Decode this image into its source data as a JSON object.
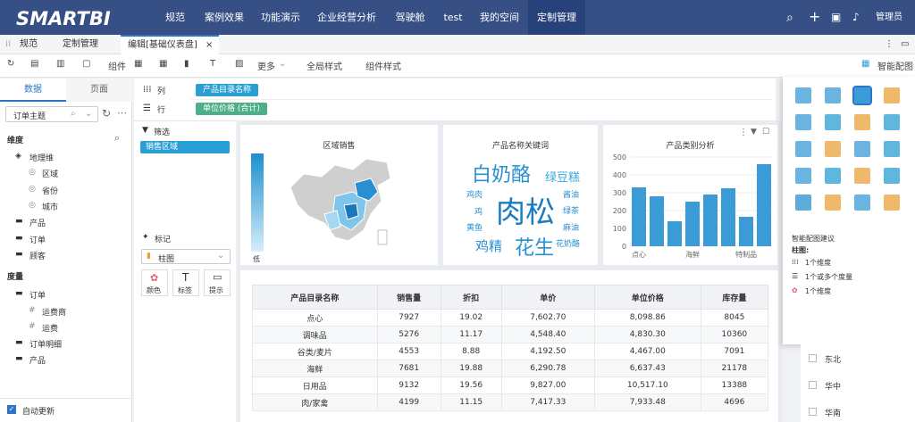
{
  "app": {
    "logo": "SMARTBI"
  },
  "nav": {
    "items": [
      "规范",
      "案例效果",
      "功能演示",
      "企业经营分析",
      "驾驶舱",
      "test",
      "我的空间",
      "定制管理"
    ],
    "active": "定制管理",
    "user": "管理员"
  },
  "tabs": {
    "items": [
      "规范",
      "定制管理",
      "编辑[基础仪表盘]"
    ],
    "close": "×"
  },
  "toolbar": {
    "component_label": "组件",
    "more": "更多",
    "global_style": "全局样式",
    "component_style": "组件样式",
    "smart_chart": "智能配图"
  },
  "left": {
    "tabs": [
      "数据",
      "页面"
    ],
    "subject": "订单主题",
    "dimension_title": "维度",
    "geo_group": "地理维",
    "geo_items": [
      "区域",
      "省份",
      "城市"
    ],
    "dim_folders": [
      "产品",
      "订单",
      "顾客"
    ],
    "measure_title": "度量",
    "order_group": "订单",
    "order_items": [
      "运费商",
      "运费"
    ],
    "measure_folders": [
      "订单明细",
      "产品"
    ],
    "auto_update": "自动更新"
  },
  "fields": {
    "col_label": "列",
    "row_label": "行",
    "col_pill": "产品目录名称",
    "row_pill": "单位价格 (合计)"
  },
  "filter": {
    "title": "筛选",
    "pill": "销售区域"
  },
  "marks": {
    "title": "标记",
    "chart_type": "柱图",
    "color": "颜色",
    "label": "标签",
    "tooltip": "提示"
  },
  "cards": {
    "map_title": "区域销售",
    "map_legend_low": "低",
    "wordcloud_title": "产品名称关键词",
    "words": [
      "白奶酪",
      "绿豆糕",
      "鸡肉",
      "酱油",
      "肉松",
      "鸡",
      "绿茶",
      "黄鱼",
      "麻油",
      "鸡精",
      "花生",
      "花奶酪"
    ],
    "bar_title": "产品类别分析"
  },
  "chart_data": {
    "type": "bar",
    "title": "产品类别分析",
    "categories": [
      "点心",
      "",
      "",
      "海鲜",
      "",
      "",
      "特制品",
      ""
    ],
    "tick_labels": [
      "点心",
      "海鲜",
      "特制品"
    ],
    "values": [
      330,
      280,
      140,
      250,
      290,
      325,
      165,
      460
    ],
    "ylim": [
      0,
      500
    ],
    "yticks": [
      0,
      100,
      200,
      300,
      400,
      500
    ],
    "color": "#3a9bd6"
  },
  "table": {
    "headers": [
      "产品目录名称",
      "销售量",
      "折扣",
      "单价",
      "单位价格",
      "库存量"
    ],
    "rows": [
      [
        "点心",
        "7927",
        "19.02",
        "7,602.70",
        "8,098.86",
        "8045"
      ],
      [
        "调味品",
        "5276",
        "11.17",
        "4,548.40",
        "4,830.30",
        "10360"
      ],
      [
        "谷类/麦片",
        "4553",
        "8.88",
        "4,192.50",
        "4,467.00",
        "7091"
      ],
      [
        "海鲜",
        "7681",
        "19.88",
        "6,290.78",
        "6,637.43",
        "21178"
      ],
      [
        "日用品",
        "9132",
        "19.56",
        "9,827.00",
        "10,517.10",
        "13388"
      ],
      [
        "肉/家禽",
        "4199",
        "11.15",
        "7,417.33",
        "7,933.48",
        "4696"
      ]
    ]
  },
  "smart": {
    "title": "智能配图建议",
    "chart_name": "柱图:",
    "requirements": [
      "1个维度",
      "1个或多个度量",
      "1个维度"
    ]
  },
  "regions": [
    "东北",
    "华中",
    "华南"
  ],
  "colors": {
    "nav": "#364f84",
    "accent": "#2a9fd6",
    "pill_green": "#4caf8a",
    "pill_blue": "#2a9fd6"
  }
}
